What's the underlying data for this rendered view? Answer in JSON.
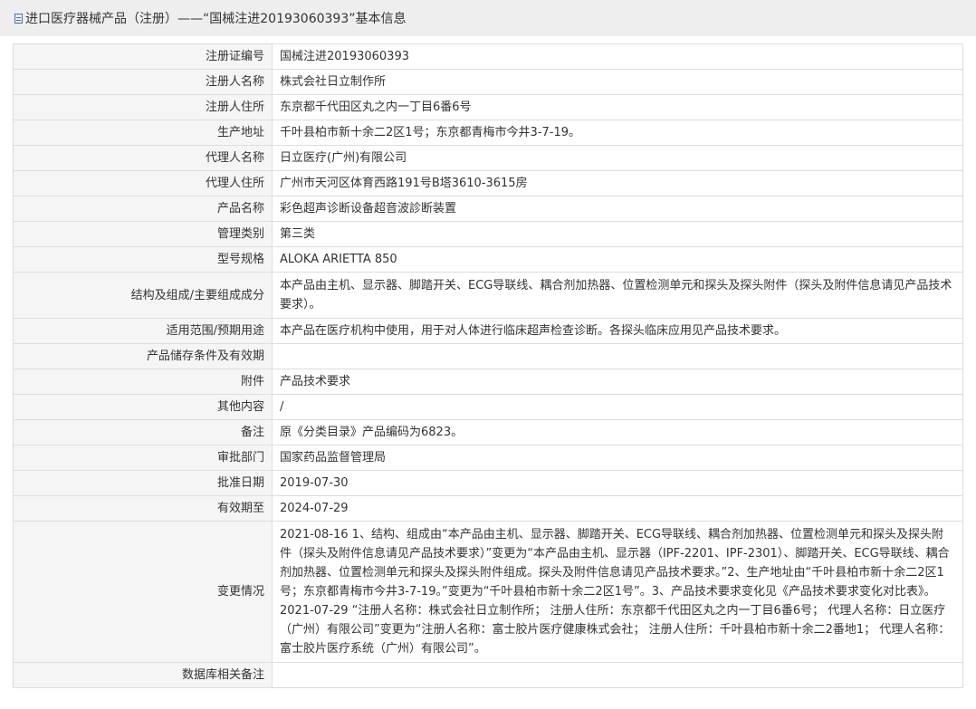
{
  "header": {
    "icon": "document-icon",
    "title": "进口医疗器械产品（注册）——“国械注进20193060393”基本信息"
  },
  "rows": [
    {
      "label": "注册证编号",
      "value": "国械注进20193060393"
    },
    {
      "label": "注册人名称",
      "value": "株式会社日立制作所"
    },
    {
      "label": "注册人住所",
      "value": "东京都千代田区丸之内一丁目6番6号"
    },
    {
      "label": "生产地址",
      "value": "千叶县柏市新十余二2区1号；东京都青梅市今井3-7-19。"
    },
    {
      "label": "代理人名称",
      "value": "日立医疗(广州)有限公司"
    },
    {
      "label": "代理人住所",
      "value": "广州市天河区体育西路191号B塔3610-3615房"
    },
    {
      "label": "产品名称",
      "value": "彩色超声诊断设备超音波診断装置"
    },
    {
      "label": "管理类别",
      "value": "第三类"
    },
    {
      "label": "型号规格",
      "value": "ALOKA ARIETTA 850"
    },
    {
      "label": "结构及组成/主要组成成分",
      "value": "本产品由主机、显示器、脚踏开关、ECG导联线、耦合剂加热器、位置检测单元和探头及探头附件（探头及附件信息请见产品技术要求）。"
    },
    {
      "label": "适用范围/预期用途",
      "value": "本产品在医疗机构中使用，用于对人体进行临床超声检查诊断。各探头临床应用见产品技术要求。"
    },
    {
      "label": "产品储存条件及有效期",
      "value": ""
    },
    {
      "label": "附件",
      "value": "产品技术要求"
    },
    {
      "label": "其他内容",
      "value": "/"
    },
    {
      "label": "备注",
      "value": "原《分类目录》产品编码为6823。"
    },
    {
      "label": "审批部门",
      "value": "国家药品监督管理局"
    },
    {
      "label": "批准日期",
      "value": "2019-07-30"
    },
    {
      "label": "有效期至",
      "value": "2024-07-29"
    },
    {
      "label": "变更情况",
      "value": "2021-08-16 1、结构、组成由“本产品由主机、显示器、脚踏开关、ECG导联线、耦合剂加热器、位置检测单元和探头及探头附件（探头及附件信息请见产品技术要求）”变更为“本产品由主机、显示器（IPF-2201、IPF-2301）、脚踏开关、ECG导联线、耦合剂加热器、位置检测单元和探头及探头附件组成。探头及附件信息请见产品技术要求。”2、生产地址由“千叶县柏市新十余二2区1号；东京都青梅市今井3-7-19。”变更为“千叶县柏市新十余二2区1号”。3、产品技术要求变化见《产品技术要求变化对比表》。 2021-07-29 “注册人名称：株式会社日立制作所； 注册人住所：东京都千代田区丸之内一丁目6番6号； 代理人名称：日立医疗（广州）有限公司”变更为“注册人名称：富士胶片医疗健康株式会社； 注册人住所：千叶县柏市新十余二2番地1； 代理人名称：富士胶片医疗系统（广州）有限公司”。"
    },
    {
      "label": "数据库相关备注",
      "value": ""
    }
  ]
}
